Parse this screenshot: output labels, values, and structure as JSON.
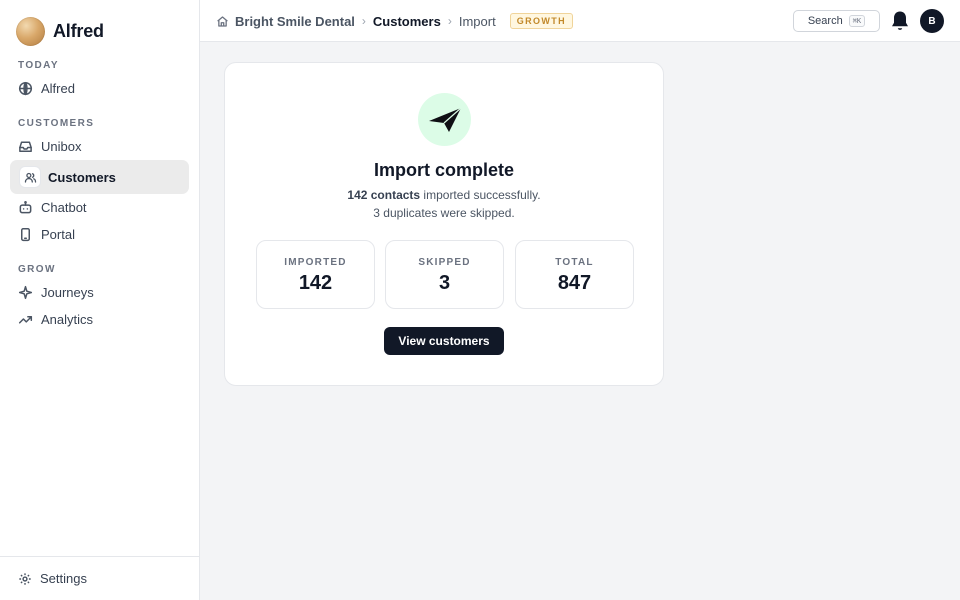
{
  "brand": {
    "name": "Alfred"
  },
  "sidebar": {
    "sections": [
      {
        "label": "TODAY"
      },
      {
        "label": "CUSTOMERS"
      },
      {
        "label": "GROW"
      }
    ],
    "items": [
      {
        "label": "Alfred",
        "icon": "globe-icon"
      },
      {
        "label": "Unibox",
        "icon": "inbox-icon"
      },
      {
        "label": "Customers",
        "icon": "users-icon",
        "active": true
      },
      {
        "label": "Chatbot",
        "icon": "bot-icon"
      },
      {
        "label": "Portal",
        "icon": "phone-icon"
      },
      {
        "label": "Journeys",
        "icon": "sparkle-icon"
      },
      {
        "label": "Analytics",
        "icon": "trend-icon"
      }
    ],
    "footer": {
      "label": "Settings",
      "icon": "gear-icon"
    }
  },
  "header": {
    "breadcrumb": [
      "Bright Smile Dental",
      "Customers",
      "Import"
    ],
    "plan_badge": "GROWTH",
    "search_label": "Search",
    "search_shortcut": "⌘K",
    "avatar_initial": "B"
  },
  "import_result": {
    "title": "Import complete",
    "imported_strong": "142 contacts",
    "imported_rest": " imported successfully.",
    "duplicates_line": "3 duplicates were skipped.",
    "stats": [
      {
        "label": "IMPORTED",
        "value": "142"
      },
      {
        "label": "SKIPPED",
        "value": "3"
      },
      {
        "label": "TOTAL",
        "value": "847"
      }
    ],
    "cta_label": "View customers"
  },
  "colors": {
    "accent_dark": "#111827",
    "success_bg": "#dcfce7",
    "badge_text": "#c2892a",
    "badge_bg": "#fff7e0"
  }
}
